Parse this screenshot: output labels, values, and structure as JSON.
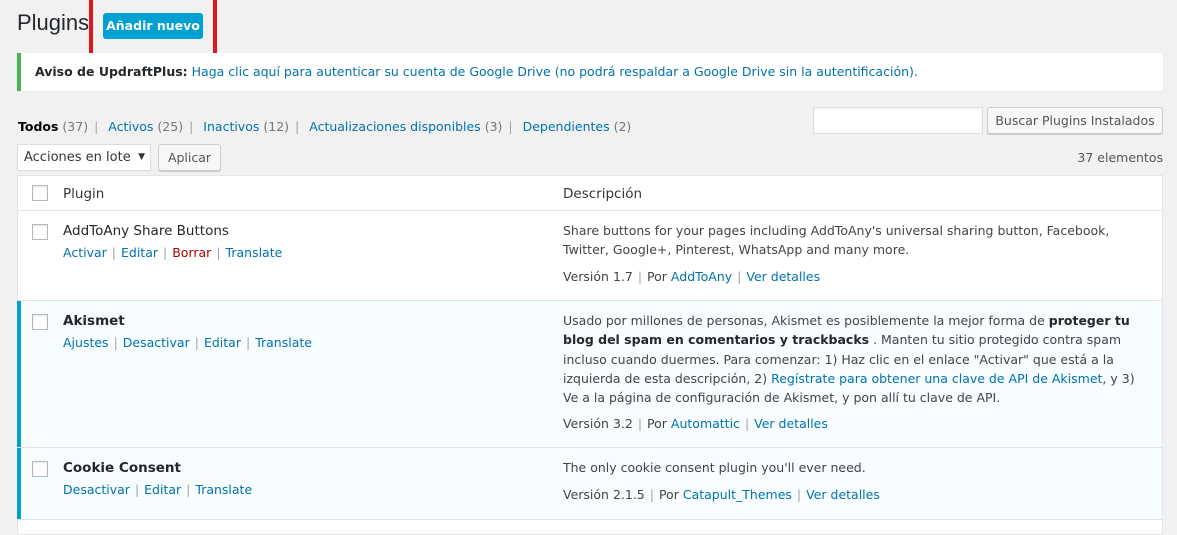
{
  "header": {
    "title": "Plugins",
    "add_new_label": "Añadir nuevo"
  },
  "notice": {
    "prefix": "Aviso de UpdraftPlus:",
    "link_text": "Haga clic aquí para autenticar su cuenta de Google Drive (no podrá respaldar a Google Drive sin la autentificación)."
  },
  "filters": [
    {
      "label": "Todos",
      "count": "(37)",
      "current": true
    },
    {
      "label": "Activos",
      "count": "(25)"
    },
    {
      "label": "Inactivos",
      "count": "(12)"
    },
    {
      "label": "Actualizaciones disponibles",
      "count": "(3)"
    },
    {
      "label": "Dependientes",
      "count": "(2)"
    }
  ],
  "search": {
    "placeholder": "",
    "button_label": "Buscar Plugins Instalados"
  },
  "bulk": {
    "selected": "Acciones en lote",
    "apply_label": "Aplicar"
  },
  "items_count": "37 elementos",
  "table": {
    "col_plugin": "Plugin",
    "col_description": "Descripción",
    "rows": [
      {
        "name": "AddToAny Share Buttons",
        "actions": [
          "Activar",
          "Editar",
          "Borrar",
          "Translate"
        ],
        "description": "Share buttons for your pages including AddToAny's universal sharing button, Facebook, Twitter, Google+, Pinterest, WhatsApp and many more.",
        "version": "Versión 1.7",
        "by_label": "Por",
        "author": "AddToAny",
        "details": "Ver detalles"
      },
      {
        "name": "Akismet",
        "actions": [
          "Ajustes",
          "Desactivar",
          "Editar",
          "Translate"
        ],
        "description_parts": {
          "p1": "Usado por millones de personas, Akismet es posiblemente la mejor forma de ",
          "bold": "proteger tu blog del spam en comentarios y trackbacks",
          "p2": " . Manten tu sitio protegido contra spam incluso cuando duermes. Para comenzar: 1) Haz clic en el enlace \"Activar\" que está a la izquierda de esta descripción, 2) ",
          "link": "Regístrate para obtener una clave de API de Akismet",
          "p3": ", y 3) Ve a la página de configuración de Akismet, y pon allí tu clave de API."
        },
        "version": "Versión 3.2",
        "by_label": "Por",
        "author": "Automattic",
        "details": "Ver detalles"
      },
      {
        "name": "Cookie Consent",
        "actions": [
          "Desactivar",
          "Editar",
          "Translate"
        ],
        "description": "The only cookie consent plugin you'll ever need.",
        "version": "Versión 2.1.5",
        "by_label": "Por",
        "author": "Catapult_Themes",
        "details": "Ver detalles"
      }
    ]
  },
  "colors": {
    "accent": "#00a0d2",
    "link": "#0073aa",
    "highlight": "#e0161c",
    "notice_border": "#46b450",
    "delete": "#aa0000"
  }
}
